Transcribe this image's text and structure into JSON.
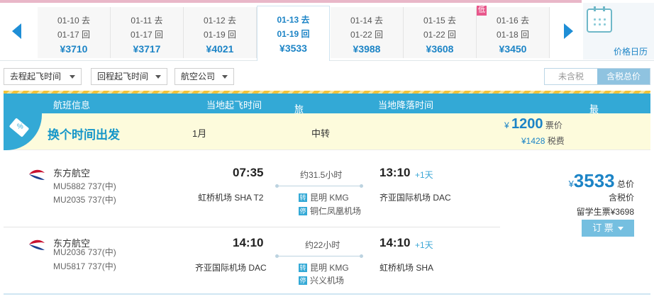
{
  "date_strip": {
    "dates": [
      {
        "depart": "01-10 去",
        "return": "01-17 回",
        "price": "¥3710",
        "active": false,
        "low": false
      },
      {
        "depart": "01-11 去",
        "return": "01-17 回",
        "price": "¥3717",
        "active": false,
        "low": false
      },
      {
        "depart": "01-12 去",
        "return": "01-19 回",
        "price": "¥4021",
        "active": false,
        "low": false
      },
      {
        "depart": "01-13 去",
        "return": "01-19 回",
        "price": "¥3533",
        "active": true,
        "low": false
      },
      {
        "depart": "01-14 去",
        "return": "01-22 回",
        "price": "¥3988",
        "active": false,
        "low": false
      },
      {
        "depart": "01-15 去",
        "return": "01-22 回",
        "price": "¥3608",
        "active": false,
        "low": false
      },
      {
        "depart": "01-16 去",
        "return": "01-18 回",
        "price": "¥3450",
        "active": false,
        "low": true
      }
    ],
    "low_badge": "低",
    "calendar_label": "价格日历"
  },
  "filters": {
    "outbound_time": "去程起飞时间",
    "return_time": "回程起飞时间",
    "airline": "航空公司"
  },
  "tax_toggle": {
    "excl": "未含税",
    "incl": "含税总价"
  },
  "columns": {
    "flight_info": "航班信息",
    "depart_time": "当地起飞时间",
    "duration": "旅行总时长",
    "arrive_time": "当地降落时间",
    "lowest_price": "最低总价",
    "sort_glyph": "↕"
  },
  "promo": {
    "title": "换个时间出发",
    "month": "1月",
    "transfer": "中转",
    "yen": "¥",
    "price": "1200",
    "price_label": "票价",
    "tax_yen_amount": "¥1428",
    "tax_label": "税费"
  },
  "legs": [
    {
      "airline": "东方航空",
      "flight1": "MU5882 737(中)",
      "flight2": "MU2035 737(中)",
      "depart_time": "07:35",
      "duration": "约31.5小时",
      "arrive_time": "13:10",
      "plus_day": "+1天",
      "depart_airport": "虹桥机场 SHA T2",
      "arrive_airport": "齐亚国际机场 DAC",
      "stop1_badge": "转",
      "stop1": "昆明 KMG",
      "stop2_badge": "停",
      "stop2": "铜仁凤凰机场"
    },
    {
      "airline": "东方航空",
      "flight1": "MU2036 737(中)",
      "flight2": "MU5817 737(中)",
      "depart_time": "14:10",
      "duration": "约22小时",
      "arrive_time": "14:10",
      "plus_day": "+1天",
      "depart_airport": "齐亚国际机场 DAC",
      "arrive_airport": "虹桥机场 SHA",
      "stop1_badge": "转",
      "stop1": "昆明 KMG",
      "stop2_badge": "停",
      "stop2": "兴义机场"
    }
  ],
  "price_box": {
    "yen": "¥",
    "total": "3533",
    "total_label": "总价",
    "incl_tax": "含税价",
    "student": "留学生票¥3698",
    "book": "订 票"
  },
  "colors": {
    "accent": "#1c84c6",
    "header": "#33a9d6",
    "airline_red": "#c8102e",
    "airline_blue": "#1d3f8f"
  }
}
